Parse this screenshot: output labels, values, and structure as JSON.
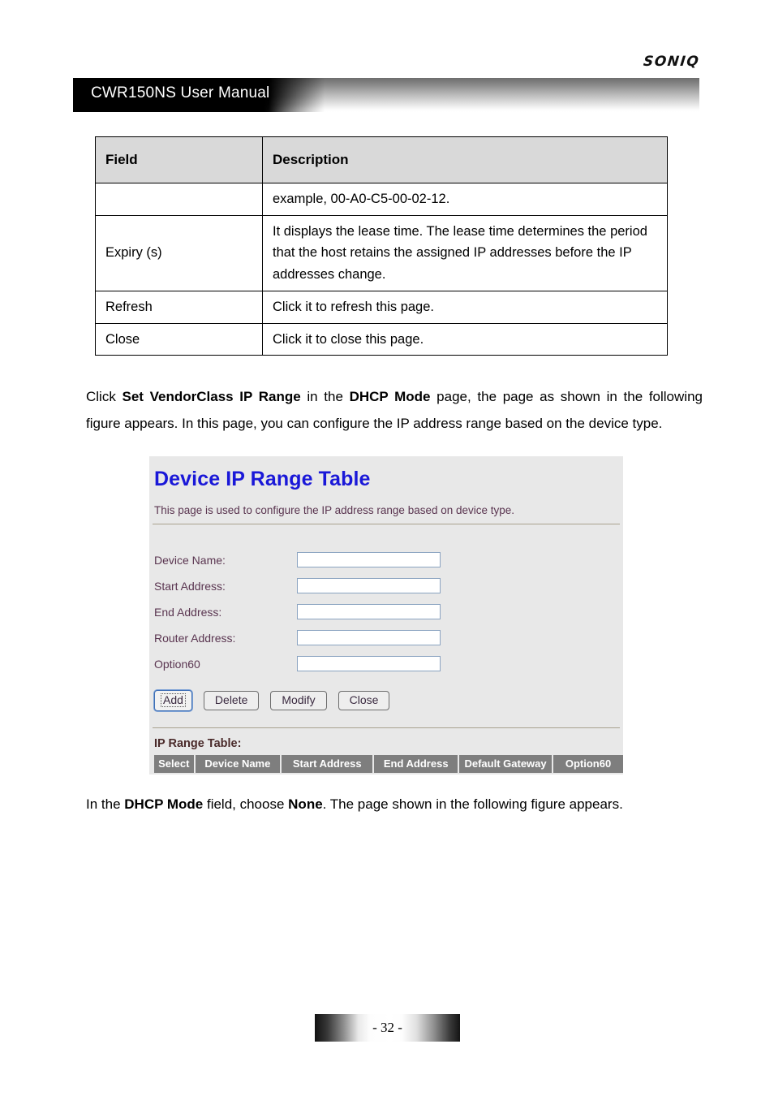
{
  "header": {
    "brand": "SONIQ",
    "manual_title": "CWR150NS User Manual"
  },
  "field_table": {
    "columns": [
      "Field",
      "Description"
    ],
    "rows": [
      {
        "field": "",
        "description": "example, 00-A0-C5-00-02-12."
      },
      {
        "field": "Expiry (s)",
        "description": "It displays the lease time. The lease time determines the period that the host retains the assigned IP addresses before the IP addresses change."
      },
      {
        "field": "Refresh",
        "description": "Click it to refresh this page."
      },
      {
        "field": "Close",
        "description": "Click it to close this page."
      }
    ]
  },
  "paragraph_1": {
    "p1_a": "Click ",
    "p1_b1": "Set VendorClass IP Range",
    "p1_c": " in the ",
    "p1_b2": "DHCP Mode",
    "p1_d": " page, the page as shown in the following figure appears. In this page, you can configure the IP address range based on the device type."
  },
  "paragraph_2": {
    "p2_a": "In the ",
    "p2_b1": "DHCP Mode",
    "p2_c": " field, choose ",
    "p2_b2": "None",
    "p2_d": ". The page shown in the following figure appears."
  },
  "ui_screenshot": {
    "title": "Device IP Range Table",
    "subtitle": "This page is used to configure the IP address range based on device type.",
    "form_fields": [
      {
        "label": "Device Name:",
        "value": ""
      },
      {
        "label": "Start Address:",
        "value": ""
      },
      {
        "label": "End Address:",
        "value": ""
      },
      {
        "label": "Router Address:",
        "value": ""
      },
      {
        "label": "Option60",
        "value": ""
      }
    ],
    "buttons": [
      {
        "label": "Add",
        "focused": true
      },
      {
        "label": "Delete",
        "focused": false
      },
      {
        "label": "Modify",
        "focused": false
      },
      {
        "label": "Close",
        "focused": false
      }
    ],
    "table_caption": "IP Range Table:",
    "table_columns": [
      "Select",
      "Device Name",
      "Start Address",
      "End Address",
      "Default Gateway",
      "Option60"
    ],
    "table_rows": [],
    "colors": {
      "title": "#1a18d8",
      "label": "#5a3550",
      "header_cell_bg": "#7e7e7e",
      "panel_bg": "#e8e8e8"
    }
  },
  "footer": {
    "page_number": "- 32 -"
  }
}
